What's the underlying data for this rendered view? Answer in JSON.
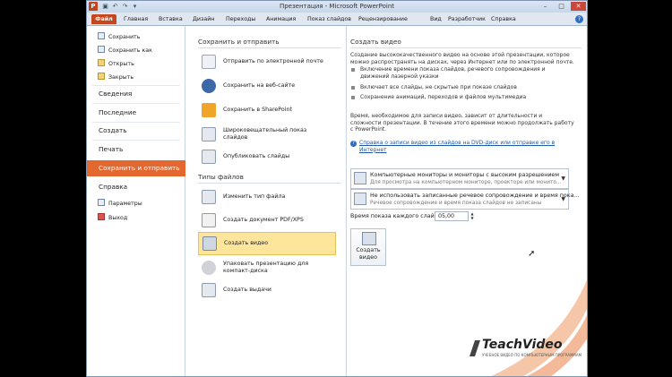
{
  "window": {
    "title": "Презентация - Microsoft PowerPoint",
    "minimize": "–",
    "maximize": "□",
    "close": "✕",
    "app_icon": "P"
  },
  "quick_access": [
    "▣",
    "↶",
    "↷",
    "▾"
  ],
  "ribbon_tabs": [
    "Файл",
    "Главная",
    "Вставка",
    "Дизайн",
    "Переходы",
    "Анимация",
    "Показ слайдов",
    "Рецензирование",
    "Вид",
    "Разработчик",
    "Справка"
  ],
  "nav": {
    "save": "Сохранить",
    "save_as": "Сохранить как",
    "open": "Открыть",
    "close": "Закрыть",
    "info": "Сведения",
    "recent": "Последние",
    "new": "Создать",
    "print": "Печать",
    "save_send": "Сохранить и отправить",
    "help": "Справка",
    "options": "Параметры",
    "exit": "Выход"
  },
  "middle": {
    "save_send_header": "Сохранить и отправить",
    "items_send": [
      "Отправить по электронной почте",
      "Сохранить на веб-сайте",
      "Сохранить в SharePoint",
      "Широковещательный показ слайдов",
      "Опубликовать слайды"
    ],
    "file_types_header": "Типы файлов",
    "items_types": [
      "Изменить тип файла",
      "Создать документ PDF/XPS",
      "Создать видео",
      "Упаковать презентацию для компакт-диска",
      "Создать выдачи"
    ]
  },
  "right": {
    "title": "Создать видео",
    "description": "Создание высококачественного видео на основе этой презентации, которое можно распространять на дисках, через Интернет или по электронной почте.",
    "bullets": [
      "Включение времени показа слайдов, речевого сопровождения и движений лазерной указки",
      "Включает все слайды, не скрытые при показе слайдов",
      "Сохранение анимаций, переходов и файлов мультимедиа"
    ],
    "time_note": "Время, необходимое для записи видео, зависит от длительности и сложности презентации. В течение этого времени можно продолжать работу с PowerPoint.",
    "help_link": "Справка о записи видео из слайдов на DVD-диск или отправке его в Интернет",
    "dropdown1": {
      "title": "Компьютерные мониторы и мониторы с высоким разрешением",
      "sub": "Для просмотра на компьютерном мониторе, проекторе или монито..."
    },
    "dropdown2": {
      "title": "Не использовать записанные речевое сопровождение и время пока...",
      "sub": "Речевое сопровождение и время показа слайдов не записаны"
    },
    "time_label": "Время показа каждого слайда:",
    "time_value": "05,00",
    "create_button": "Создать видео"
  },
  "logo": {
    "name": "TeachVideo",
    "sub": "УЧЕБНОЕ ВИДЕО ПО КОМПЬЮТЕРНЫМ ПРОГРАММАМ"
  }
}
